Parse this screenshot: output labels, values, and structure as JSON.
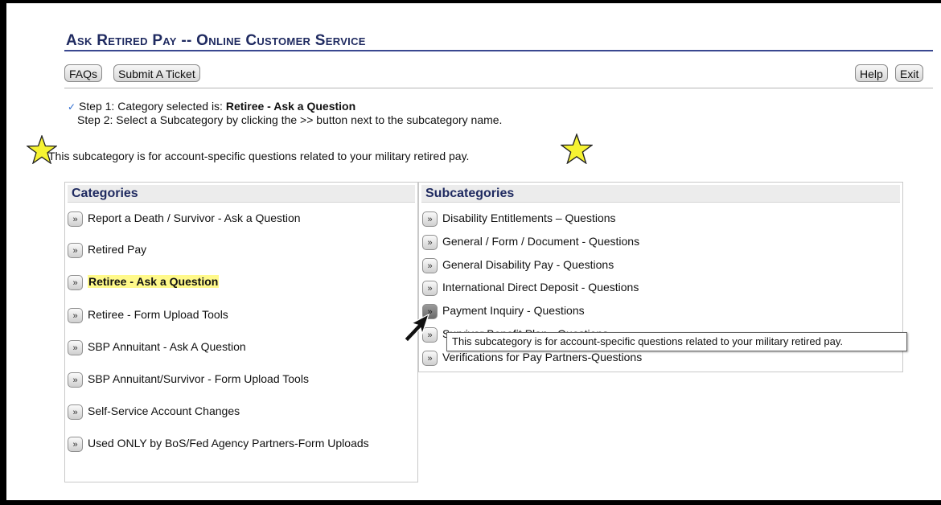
{
  "header": {
    "title": "Ask Retired Pay -- Online Customer Service"
  },
  "toolbar": {
    "faqs_label": "FAQs",
    "submit_label": "Submit A Ticket",
    "help_label": "Help",
    "exit_label": "Exit"
  },
  "steps": {
    "check": "✓",
    "step1_prefix": "Step 1: Category selected is: ",
    "step1_value": "Retiree - Ask a Question",
    "step2": "Step 2: Select a Subcategory by clicking the >> button next to the subcategory name."
  },
  "info": {
    "text": "This subcategory is for account-specific questions related to your military retired pay.",
    "star_icon": "star-icon",
    "star_color": "#f6f332"
  },
  "categories": {
    "header": "Categories",
    "button_glyph": "»",
    "highlight_color": "#fff98a",
    "items": [
      {
        "label": "Report a Death / Survivor - Ask a Question"
      },
      {
        "label": "Retired Pay"
      },
      {
        "label": "Retiree - Ask a Question",
        "selected": true
      },
      {
        "label": "Retiree - Form Upload Tools"
      },
      {
        "label": "SBP Annuitant - Ask A Question"
      },
      {
        "label": "SBP Annuitant/Survivor - Form Upload Tools"
      },
      {
        "label": "Self-Service Account Changes"
      },
      {
        "label": "Used ONLY by BoS/Fed Agency Partners-Form Uploads"
      }
    ]
  },
  "subcategories": {
    "header": "Subcategories",
    "button_glyph": "»",
    "items": [
      {
        "label": "Disability Entitlements – Questions"
      },
      {
        "label": "General / Form / Document - Questions"
      },
      {
        "label": "General Disability Pay - Questions"
      },
      {
        "label": "International Direct Deposit - Questions"
      },
      {
        "label": "Payment Inquiry - Questions",
        "hovered": true
      },
      {
        "label": "Survivor Benefit Plan - Questions"
      },
      {
        "label": "Verifications for Pay Partners-Questions"
      }
    ]
  },
  "tooltip": {
    "text": "This subcategory is for account-specific questions related to your military retired pay."
  },
  "cursor": {
    "icon": "arrow-cursor-icon"
  }
}
